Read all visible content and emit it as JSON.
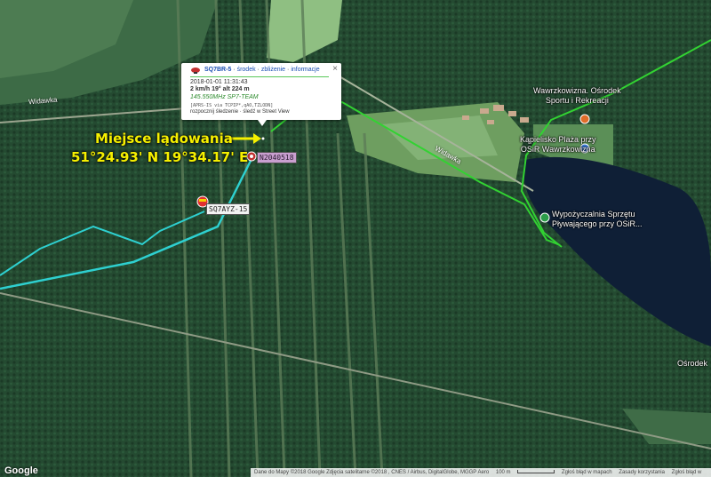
{
  "map": {
    "type": "satellite",
    "colors": {
      "forest": "#244a31",
      "field": "#6a9a62",
      "lake": "#0f1f36",
      "track_green": "#32d232",
      "track_cyan": "#2ed0d0",
      "annotation": "#f6f000"
    }
  },
  "annotation": {
    "title": "Miejsce lądowania",
    "coords": "51°24.93' N 19°34.17' E",
    "arrow": "right-arrow"
  },
  "popup": {
    "icon": "balloon-icon",
    "callsign": "SQ7BR-5",
    "links": [
      "środek",
      "zbliżenie",
      "informacje"
    ],
    "separator": " · ",
    "close": "×",
    "timestamp": "2018-01-01 11:31:43",
    "speed": "2 km/h 19° alt 224 m",
    "comment": "145.550MHz SP7-TEAM",
    "path": "[APRS-IS via TCPIP*,qAO,TZLODN]",
    "tools": "rozpocznij śledzenie · śledź w Street View"
  },
  "stations": [
    {
      "label": "N2040518",
      "icon": "target-marker-icon"
    },
    {
      "label": "SQ7AYZ-15",
      "icon": "station-marker-icon"
    }
  ],
  "places": [
    {
      "name": "Wawrzkowizna. Ośrodek Sportu i Rekreacji",
      "lines": [
        "Wawrzkowizna. Ośrodek",
        "Sportu i Rekreacji"
      ],
      "icon": "hotel-icon"
    },
    {
      "name": "Kąpielisko Plaża przy OSiR Wawrzkowizna",
      "lines": [
        "Kąpielisko Plaża przy",
        "OSiR Wawrzkowizna"
      ],
      "icon": "swim-icon"
    },
    {
      "name": "Wypożyczalnia Sprzętu Pływającego przy OSiR...",
      "lines": [
        "Wypożyczalnia Sprzętu",
        "Pływającego przy OSiR..."
      ],
      "icon": "boat-rental-icon"
    },
    {
      "name": "Ośrodek",
      "lines": [
        "Ośrodek"
      ],
      "icon": "place-icon"
    }
  ],
  "roads": [
    "Widawka",
    "Widawka"
  ],
  "footer": {
    "attribution": "Dane do Mapy ©2018 Google Zdjęcia satelitarne ©2018 , CNES / Airbus, DigitalGlobe, MGGP Aero",
    "scale": "100 m",
    "report": "Zgłoś błąd w mapach",
    "terms": "Zasady korzystania",
    "last": "Zgłoś błąd w"
  },
  "logo": "Google"
}
